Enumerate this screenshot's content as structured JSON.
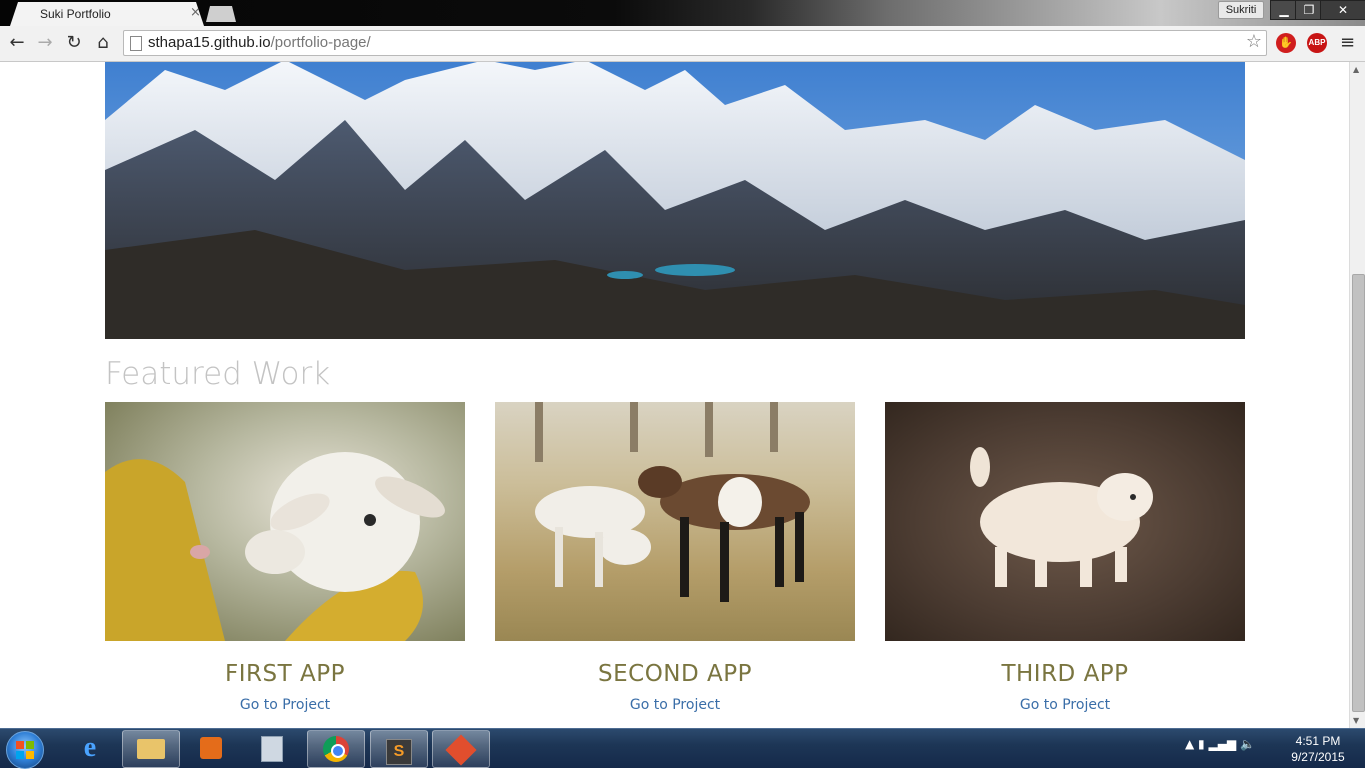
{
  "browser": {
    "tab_title": "Suki Portfolio",
    "tab_close": "×",
    "profile_name": "Sukriti",
    "url_host": "sthapa15.github.io",
    "url_path": "/portfolio-page/",
    "window_controls": {
      "minimize": "▁",
      "maximize": "❐",
      "close": "✕"
    },
    "nav": {
      "back": "←",
      "forward": "→",
      "reload": "↻",
      "home": "⌂"
    },
    "star": "☆",
    "ext_stop": "✋",
    "ext_abp": "ABP",
    "menu": "≡"
  },
  "page": {
    "section_title": "Featured Work",
    "projects": [
      {
        "title": "FIRST APP",
        "link": "Go to Project"
      },
      {
        "title": "SECOND APP",
        "link": "Go to Project"
      },
      {
        "title": "THIRD APP",
        "link": "Go to Project"
      }
    ]
  },
  "scrollbar": {
    "up": "▲",
    "down": "▼"
  },
  "taskbar": {
    "ie_glyph": "e",
    "sublime_glyph": "S",
    "tray": "▲  ▮  ▂▄▆  🔈",
    "time": "4:51 PM",
    "date": "9/27/2015"
  },
  "colors": {
    "section_title": "#c3c3c3",
    "project_title": "#7a7540",
    "project_link": "#3a6ea8"
  }
}
